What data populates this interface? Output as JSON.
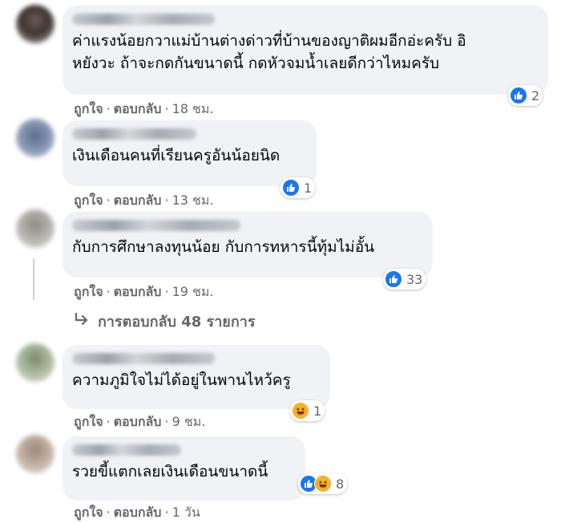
{
  "comments": [
    {
      "text": "ค่าแรงน้อยกวาแม่บ้านต่างด่าวที่บ้านของญาติผมอีกอ่ะครับ อิ\nหยังวะ ถ้าจะกดกันขนาดนี้ กดหัวจมน้ำเลยดีกว่าไหมครับ",
      "like_label": "ถูกใจ",
      "reply_label": "ตอบกลับ",
      "time": "18 ชม.",
      "reaction_count": "2",
      "reactions": [
        "like-icon"
      ]
    },
    {
      "text": "เงินเดือนคนที่เรียนครูอันน้อยนิด",
      "like_label": "ถูกใจ",
      "reply_label": "ตอบกลับ",
      "time": "13 ชม.",
      "reaction_count": "1",
      "reactions": [
        "like-icon"
      ]
    },
    {
      "text": "กับการศึกษาลงทุนน้อย กับการทหารนี้ทุ้มไม่อั้น",
      "like_label": "ถูกใจ",
      "reply_label": "ตอบกลับ",
      "time": "19 ชม.",
      "reaction_count": "33",
      "reactions": [
        "like-icon"
      ]
    },
    {
      "text": "ความภูมิใจไม่ได้อยู่ในพานไหว้ครู",
      "like_label": "ถูกใจ",
      "reply_label": "ตอบกลับ",
      "time": "9 ชม.",
      "reaction_count": "1",
      "reactions": [
        "haha-icon"
      ]
    },
    {
      "text": "รวยขี้แตกเลยเงินเดือนขนาดนี้",
      "like_label": "ถูกใจ",
      "reply_label": "ตอบกลับ",
      "time": "1 วัน",
      "reaction_count": "8",
      "reactions": [
        "like-icon",
        "haha-icon"
      ]
    }
  ],
  "view_replies": {
    "label": "การตอบกลับ 48 รายการ",
    "icon": "reply-arrow-icon"
  },
  "colors": {
    "bubble": "#f0f2f5",
    "like": "#1877f2",
    "haha": "#f7b125",
    "secondary_text": "#65676b"
  }
}
